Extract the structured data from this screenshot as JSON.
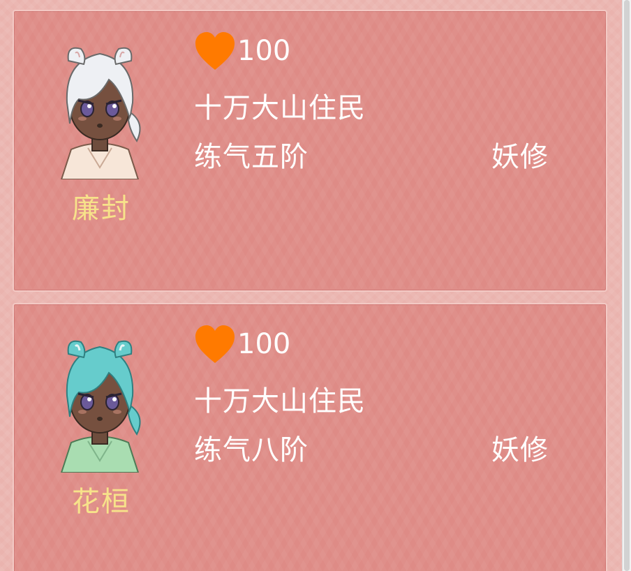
{
  "cards": [
    {
      "name": "廉封",
      "hp": "100",
      "origin": "十万大山住民",
      "realm": "练气五阶",
      "type": "妖修",
      "hair_color": "#eef0f4",
      "robe_color": "#f7e6d8"
    },
    {
      "name": "花桓",
      "hp": "100",
      "origin": "十万大山住民",
      "realm": "练气八阶",
      "type": "妖修",
      "hair_color": "#66cccc",
      "robe_color": "#a9ddb1"
    }
  ],
  "colors": {
    "card_bg": "#de8b86",
    "name": "#f7e28a",
    "heart": "#ff7a00",
    "text": "#ffffff"
  },
  "icons": {
    "hp": "heart-icon"
  }
}
